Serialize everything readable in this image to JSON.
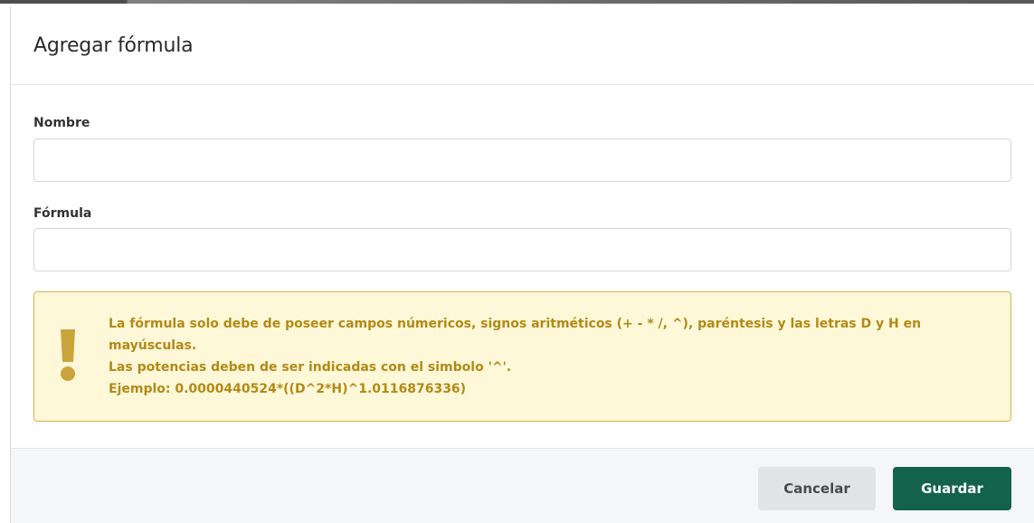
{
  "dialog": {
    "title": "Agregar fórmula"
  },
  "form": {
    "nombre": {
      "label": "Nombre",
      "value": "",
      "placeholder": ""
    },
    "formula": {
      "label": "Fórmula",
      "value": "",
      "placeholder": ""
    }
  },
  "alert": {
    "icon": "exclamation-icon",
    "lines": [
      "La fórmula solo debe de poseer campos númericos, signos aritméticos (+ - * /, ^), paréntesis y las letras D y H en",
      "mayúsculas.",
      "Las potencias deben de ser indicadas con el simbolo '^'.",
      "Ejemplo: 0.0000440524*((D^2*H)^1.0116876336)"
    ],
    "colors": {
      "background": "#fef8d9",
      "border": "#d6b34c",
      "text": "#b28a15"
    }
  },
  "footer": {
    "cancel_label": "Cancelar",
    "save_label": "Guardar",
    "colors": {
      "save": "#13624c",
      "cancel": "#e2e3e5"
    }
  }
}
